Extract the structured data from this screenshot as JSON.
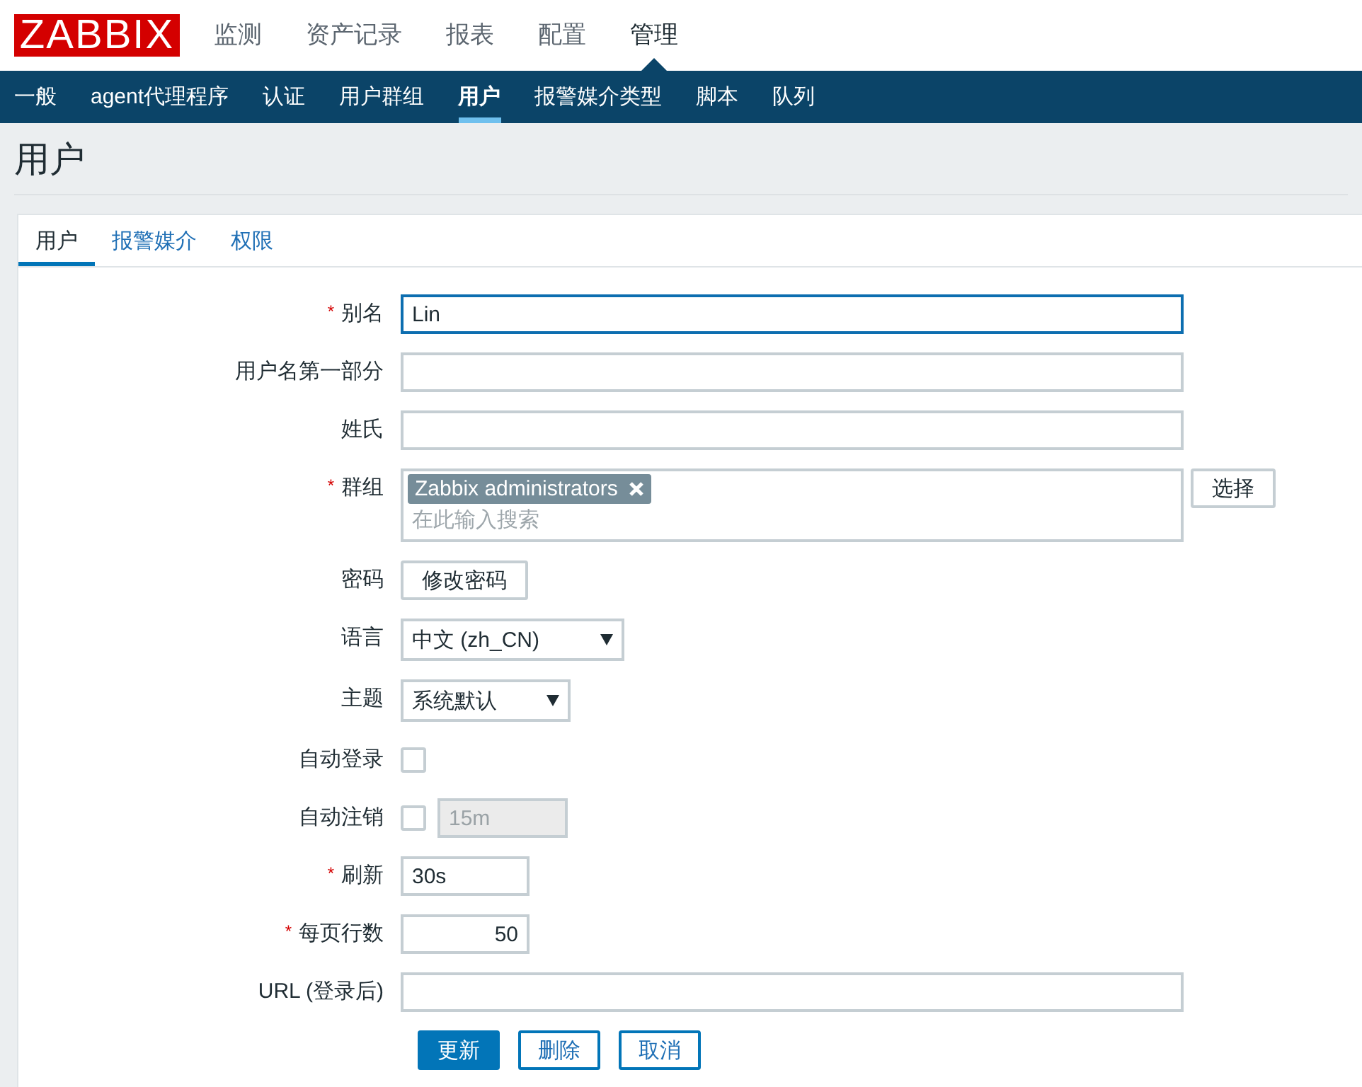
{
  "header": {
    "logo": "ZABBIX",
    "menu": [
      {
        "label": "监测",
        "selected": false
      },
      {
        "label": "资产记录",
        "selected": false
      },
      {
        "label": "报表",
        "selected": false
      },
      {
        "label": "配置",
        "selected": false
      },
      {
        "label": "管理",
        "selected": true
      }
    ]
  },
  "submenu": [
    {
      "label": "一般",
      "selected": false
    },
    {
      "label": "agent代理程序",
      "selected": false
    },
    {
      "label": "认证",
      "selected": false
    },
    {
      "label": "用户群组",
      "selected": false
    },
    {
      "label": "用户",
      "selected": true
    },
    {
      "label": "报警媒介类型",
      "selected": false
    },
    {
      "label": "脚本",
      "selected": false
    },
    {
      "label": "队列",
      "selected": false
    }
  ],
  "page_title": "用户",
  "tabs": [
    {
      "label": "用户",
      "selected": true
    },
    {
      "label": "报警媒介",
      "selected": false
    },
    {
      "label": "权限",
      "selected": false
    }
  ],
  "form": {
    "required_mark": "*",
    "rows": [
      {
        "kind": "text",
        "label": "别名",
        "required": true,
        "value": "Lin",
        "focused": true
      },
      {
        "kind": "text",
        "label": "用户名第一部分",
        "required": false,
        "focused": false
      },
      {
        "kind": "text",
        "label": "姓氏",
        "required": false,
        "focused": false
      },
      {
        "kind": "multiselect",
        "label": "群组",
        "required": true,
        "tags": [
          "Zabbix administrators"
        ],
        "placeholder": "在此输入搜索",
        "button": "选择"
      },
      {
        "kind": "button",
        "label": "密码",
        "required": false,
        "button": "修改密码"
      },
      {
        "kind": "select",
        "label": "语言",
        "required": false,
        "value": "中文 (zh_CN)"
      },
      {
        "kind": "select",
        "label": "主题",
        "required": false,
        "value": "系统默认"
      },
      {
        "kind": "checkbox",
        "label": "自动登录",
        "required": false,
        "checked": false
      },
      {
        "kind": "checkbox",
        "label": "自动注销",
        "required": false,
        "checked": false,
        "input": {
          "value": "15m",
          "disabled": true
        }
      },
      {
        "kind": "short",
        "label": "刷新",
        "required": true,
        "value": "30s"
      },
      {
        "kind": "number",
        "label": "每页行数",
        "required": true,
        "value": "50"
      },
      {
        "kind": "text",
        "label": "URL (登录后)",
        "required": false,
        "focused": false
      }
    ],
    "actions": [
      {
        "label": "更新",
        "primary": true
      },
      {
        "label": "删除",
        "primary": false
      },
      {
        "label": "取消",
        "primary": false
      }
    ]
  }
}
